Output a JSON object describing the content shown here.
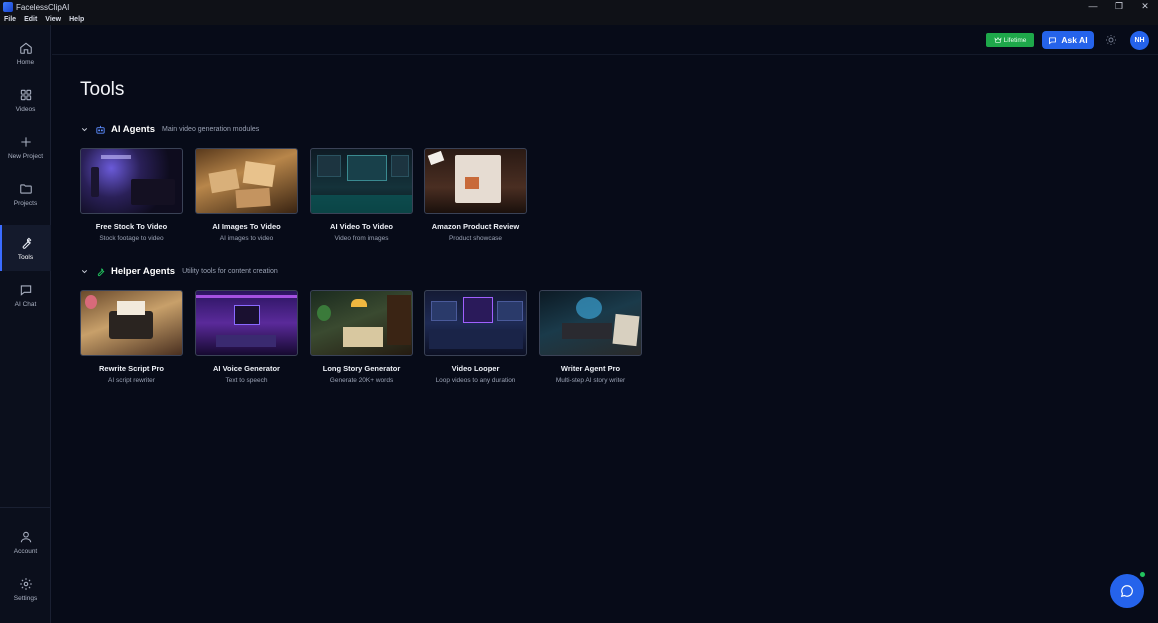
{
  "app": {
    "title": "FacelessClipAI"
  },
  "window_controls": {
    "minimize": "—",
    "maximize": "❐",
    "close": "✕"
  },
  "menu": [
    "File",
    "Edit",
    "View",
    "Help"
  ],
  "sidebar": {
    "items": [
      {
        "label": "Home",
        "icon": "home-icon"
      },
      {
        "label": "Videos",
        "icon": "grid-icon"
      },
      {
        "label": "New Project",
        "icon": "plus-icon"
      },
      {
        "label": "Projects",
        "icon": "folder-icon"
      },
      {
        "label": "Tools",
        "icon": "wrench-icon",
        "active": true
      },
      {
        "label": "AI Chat",
        "icon": "chat-icon"
      }
    ],
    "bottom_items": [
      {
        "label": "Account",
        "icon": "user-icon"
      },
      {
        "label": "Settings",
        "icon": "gear-icon"
      }
    ]
  },
  "topbar": {
    "lifetime_label": "Lifetime",
    "ask_ai_label": "Ask AI",
    "avatar_initials": "NH"
  },
  "page": {
    "title": "Tools"
  },
  "sections": [
    {
      "title": "AI Agents",
      "subtitle": "Main video generation modules",
      "cards": [
        {
          "title": "Free Stock To Video",
          "subtitle": "Stock footage to video"
        },
        {
          "title": "AI Images To Video",
          "subtitle": "AI images to video"
        },
        {
          "title": "AI Video To Video",
          "subtitle": "Video from images"
        },
        {
          "title": "Amazon Product Review",
          "subtitle": "Product showcase"
        }
      ]
    },
    {
      "title": "Helper Agents",
      "subtitle": "Utility tools for content creation",
      "cards": [
        {
          "title": "Rewrite Script Pro",
          "subtitle": "AI script rewriter"
        },
        {
          "title": "AI Voice Generator",
          "subtitle": "Text to speech"
        },
        {
          "title": "Long Story Generator",
          "subtitle": "Generate 20K+ words"
        },
        {
          "title": "Video Looper",
          "subtitle": "Loop videos to any duration"
        },
        {
          "title": "Writer Agent Pro",
          "subtitle": "Multi-step AI story writer"
        }
      ]
    }
  ],
  "colors": {
    "accent": "#2563eb",
    "lifetime": "#1ea84a",
    "background": "#070b18",
    "sidebar": "#0b0f1c"
  }
}
